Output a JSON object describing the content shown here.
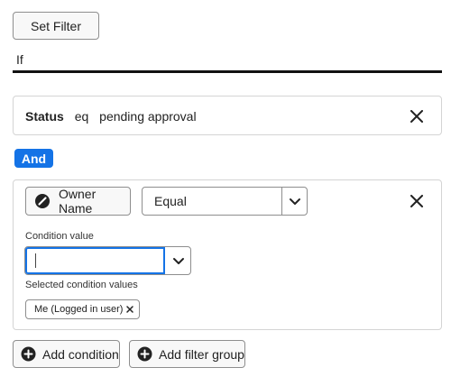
{
  "toolbar": {
    "set_filter_label": "Set Filter"
  },
  "group": {
    "if_label": "If"
  },
  "status_rule": {
    "field": "Status",
    "operator": "eq",
    "value": "pending approval"
  },
  "connector": {
    "label": "And"
  },
  "condition": {
    "field_label": "Owner Name",
    "field_icon": "slash-circle-icon",
    "operator_value": "Equal",
    "value_label": "Condition value",
    "value_input": "",
    "selected_label": "Selected condition values",
    "selected_values": [
      "Me (Logged in user)"
    ]
  },
  "actions": {
    "add_condition_label": "Add condition",
    "add_group_label": "Add filter group"
  },
  "colors": {
    "accent": "#1473e6",
    "border": "#8e8e8e",
    "divider": "#111111"
  }
}
